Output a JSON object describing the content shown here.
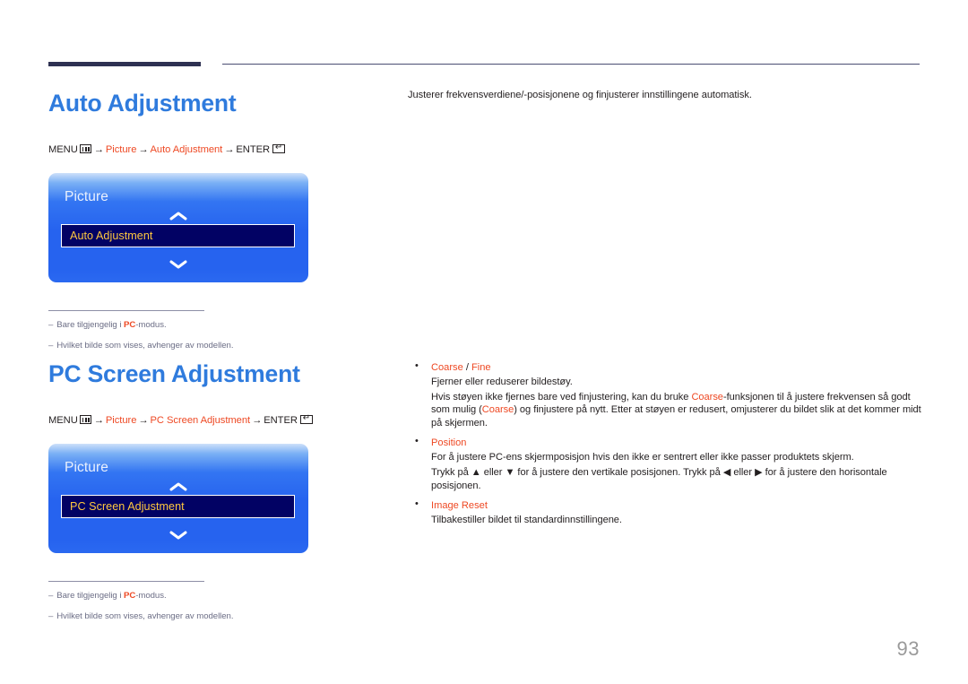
{
  "page": {
    "number": "93"
  },
  "sections": [
    {
      "id": "auto-adjustment",
      "title": "Auto Adjustment",
      "path": {
        "menu_label": "MENU",
        "menu_icon": "menu-grid-icon",
        "arrow": "→",
        "items": [
          "Picture",
          "Auto Adjustment"
        ],
        "enter_label": "ENTER",
        "enter_icon": "enter-return-icon"
      },
      "osd": {
        "title": "Picture",
        "up_icon": "chevron-up-icon",
        "down_icon": "chevron-down-icon",
        "selected_item": "Auto Adjustment"
      },
      "notes": [
        {
          "dash": "–",
          "pre": "Bare tilgjengelig i ",
          "hl": "PC",
          "post": "-modus."
        },
        {
          "dash": "–",
          "pre": "Hvilket bilde som vises, avhenger av modellen.",
          "hl": "",
          "post": ""
        }
      ],
      "description": "Justerer frekvensverdiene/-posisjonene og finjusterer innstillingene automatisk."
    },
    {
      "id": "pc-screen-adjustment",
      "title": "PC Screen Adjustment",
      "path": {
        "menu_label": "MENU",
        "menu_icon": "menu-grid-icon",
        "arrow": "→",
        "items": [
          "Picture",
          "PC Screen Adjustment"
        ],
        "enter_label": "ENTER",
        "enter_icon": "enter-return-icon"
      },
      "osd": {
        "title": "Picture",
        "up_icon": "chevron-up-icon",
        "down_icon": "chevron-down-icon",
        "selected_item": "PC Screen Adjustment"
      },
      "notes": [
        {
          "dash": "–",
          "pre": "Bare tilgjengelig i ",
          "hl": "PC",
          "post": "-modus."
        },
        {
          "dash": "–",
          "pre": "Hvilket bilde som vises, avhenger av modellen.",
          "hl": "",
          "post": ""
        }
      ],
      "bullets": [
        {
          "title_hl_1": "Coarse",
          "title_sep": " / ",
          "title_hl_2": "Fine",
          "paragraphs": [
            {
              "t1": "Fjerner eller reduserer bildestøy."
            },
            {
              "t1": "Hvis støyen ikke fjernes bare ved finjustering, kan du bruke ",
              "h1": "Coarse",
              "t2": "-funksjonen til å justere frekvensen så godt som mulig (",
              "h2": "Coarse",
              "t3": ") og finjustere på nytt. Etter at støyen er redusert, omjusterer du bildet slik at det kommer midt på skjermen."
            }
          ]
        },
        {
          "title_hl_1": "Position",
          "title_sep": "",
          "title_hl_2": "",
          "paragraphs": [
            {
              "t1": "For å justere PC-ens skjermposisjon hvis den ikke er sentrert eller ikke passer produktets skjerm."
            },
            {
              "t1": "Trykk på ▲ eller ▼ for å justere den vertikale posisjonen. Trykk på ◀ eller ▶ for å justere den horisontale posisjonen."
            }
          ]
        },
        {
          "title_hl_1": "Image Reset",
          "title_sep": "",
          "title_hl_2": "",
          "paragraphs": [
            {
              "t1": "Tilbakestiller bildet til standardinnstillingene."
            }
          ]
        }
      ]
    }
  ],
  "colors": {
    "heading_blue": "#2f7bdd",
    "accent_orange": "#ee4924",
    "rule_navy": "#2e3152",
    "osd_blue": "#2663ef",
    "osd_highlight_navy": "#020264",
    "osd_highlight_text": "#ffc83f",
    "note_gray": "#6c6e86",
    "page_number_gray": "#9a9a9a"
  }
}
